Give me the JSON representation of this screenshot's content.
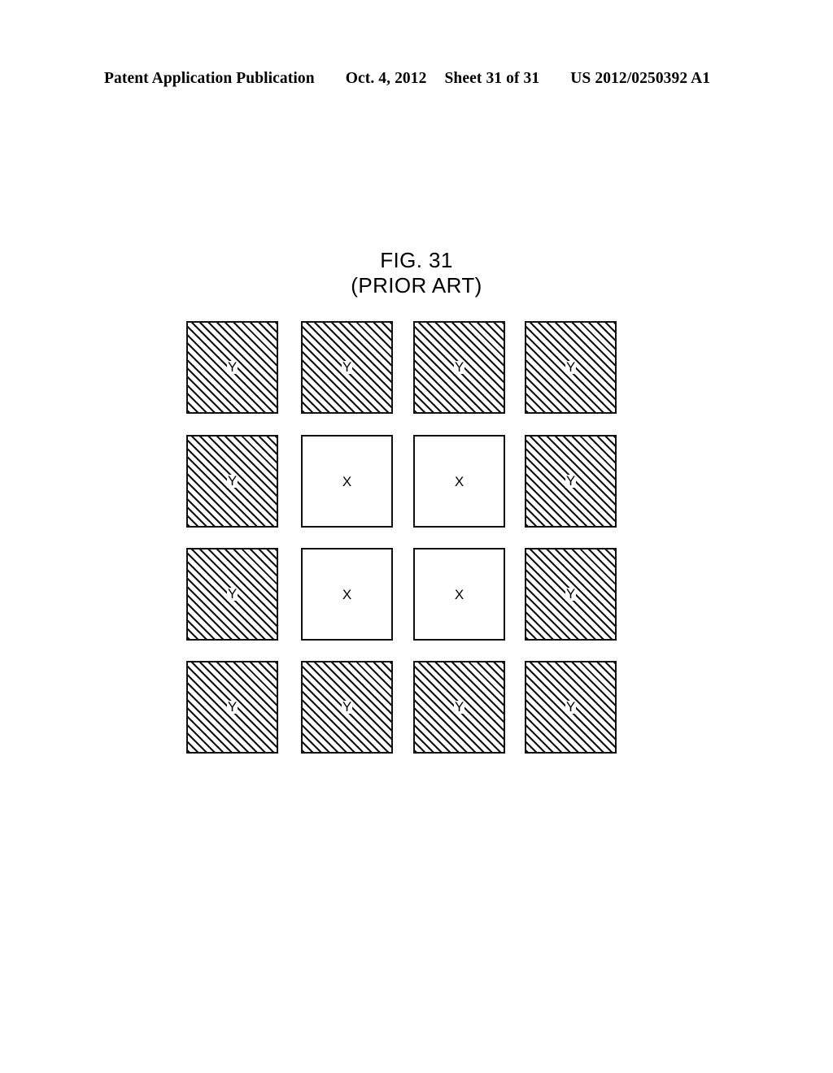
{
  "header": {
    "publication": "Patent Application Publication",
    "date": "Oct. 4, 2012",
    "sheet": "Sheet 31 of 31",
    "document_number": "US 2012/0250392 A1"
  },
  "figure": {
    "title": "FIG. 31",
    "subtitle": "(PRIOR ART)",
    "grid": {
      "rows": 4,
      "columns": 4,
      "cells": [
        [
          {
            "label": "Y",
            "fill": "hatched"
          },
          {
            "label": "Y",
            "fill": "hatched"
          },
          {
            "label": "Y",
            "fill": "hatched"
          },
          {
            "label": "Y",
            "fill": "hatched"
          }
        ],
        [
          {
            "label": "Y",
            "fill": "hatched"
          },
          {
            "label": "X",
            "fill": "white"
          },
          {
            "label": "X",
            "fill": "white"
          },
          {
            "label": "Y",
            "fill": "hatched"
          }
        ],
        [
          {
            "label": "Y",
            "fill": "hatched"
          },
          {
            "label": "X",
            "fill": "white"
          },
          {
            "label": "X",
            "fill": "white"
          },
          {
            "label": "Y",
            "fill": "hatched"
          }
        ],
        [
          {
            "label": "Y",
            "fill": "hatched"
          },
          {
            "label": "Y",
            "fill": "hatched"
          },
          {
            "label": "Y",
            "fill": "hatched"
          },
          {
            "label": "Y",
            "fill": "hatched"
          }
        ]
      ]
    },
    "colors": {
      "ink": "#111111",
      "paper": "#ffffff"
    }
  }
}
